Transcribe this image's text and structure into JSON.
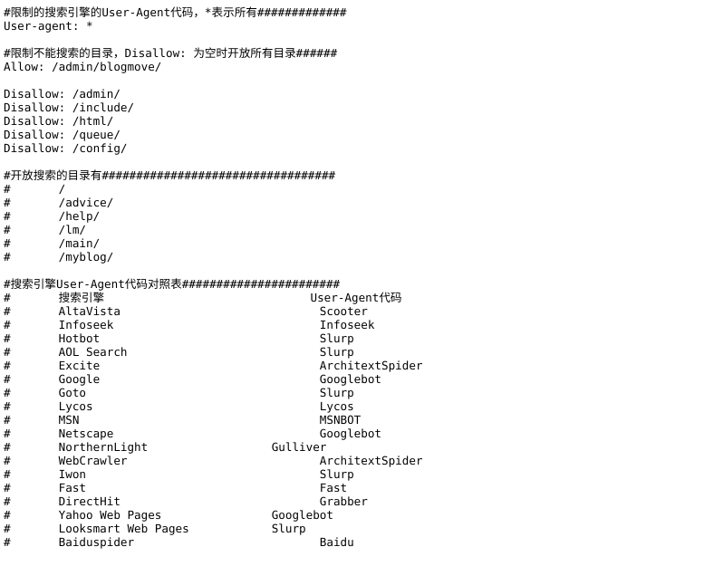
{
  "document": {
    "kind": "robots.txt",
    "colors": {
      "background": "#ffffff",
      "text": "#000000"
    },
    "lines": [
      "#限制的搜索引擎的User-Agent代码，*表示所有#############",
      "User-agent: *",
      "",
      "#限制不能搜索的目录，Disallow: 为空时开放所有目录######",
      "Allow: /admin/blogmove/",
      "",
      "Disallow: /admin/",
      "Disallow: /include/",
      "Disallow: /html/",
      "Disallow: /queue/",
      "Disallow: /config/",
      "",
      "#开放搜索的目录有##################################",
      "#       /",
      "#       /advice/",
      "#       /help/",
      "#       /lm/",
      "#       /main/",
      "#       /myblog/",
      "",
      "#搜索引擎User-Agent代码对照表#######################",
      "#       搜索引擎                              User-Agent代码",
      "#       AltaVista                             Scooter",
      "#       Infoseek                              Infoseek",
      "#       Hotbot                                Slurp",
      "#       AOL Search                            Slurp",
      "#       Excite                                ArchitextSpider",
      "#       Google                                Googlebot",
      "#       Goto                                  Slurp",
      "#       Lycos                                 Lycos",
      "#       MSN                                   MSNBOT",
      "#       Netscape                              Googlebot",
      "#       NorthernLight                  Gulliver",
      "#       WebCrawler                            ArchitextSpider",
      "#       Iwon                                  Slurp",
      "#       Fast                                  Fast",
      "#       DirectHit                             Grabber",
      "#       Yahoo Web Pages                Googlebot",
      "#       Looksmart Web Pages            Slurp",
      "#       Baiduspider                           Baidu"
    ],
    "sections": {
      "user_agent_comment": "#限制的搜索引擎的User-Agent代码，*表示所有#############",
      "user_agent_rule": "User-agent: *",
      "disallow_comment": "#限制不能搜索的目录，Disallow: 为空时开放所有目录######",
      "allow_rule": "Allow: /admin/blogmove/",
      "disallow_rules": [
        "Disallow: /admin/",
        "Disallow: /include/",
        "Disallow: /html/",
        "Disallow: /queue/",
        "Disallow: /config/"
      ],
      "open_dirs_comment": "#开放搜索的目录有##################################",
      "open_dirs": [
        "/",
        "/advice/",
        "/help/",
        "/lm/",
        "/main/",
        "/myblog/"
      ],
      "table_comment": "#搜索引擎User-Agent代码对照表#######################",
      "table_headers": [
        "搜索引擎",
        "User-Agent代码"
      ],
      "table_rows": [
        [
          "AltaVista",
          "Scooter"
        ],
        [
          "Infoseek",
          "Infoseek"
        ],
        [
          "Hotbot",
          "Slurp"
        ],
        [
          "AOL Search",
          "Slurp"
        ],
        [
          "Excite",
          "ArchitextSpider"
        ],
        [
          "Google",
          "Googlebot"
        ],
        [
          "Goto",
          "Slurp"
        ],
        [
          "Lycos",
          "Lycos"
        ],
        [
          "MSN",
          "MSNBOT"
        ],
        [
          "Netscape",
          "Googlebot"
        ],
        [
          "NorthernLight",
          "Gulliver"
        ],
        [
          "WebCrawler",
          "ArchitextSpider"
        ],
        [
          "Iwon",
          "Slurp"
        ],
        [
          "Fast",
          "Fast"
        ],
        [
          "DirectHit",
          "Grabber"
        ],
        [
          "Yahoo Web Pages",
          "Googlebot"
        ],
        [
          "Looksmart Web Pages",
          "Slurp"
        ],
        [
          "Baiduspider",
          "Baidu"
        ]
      ]
    }
  }
}
